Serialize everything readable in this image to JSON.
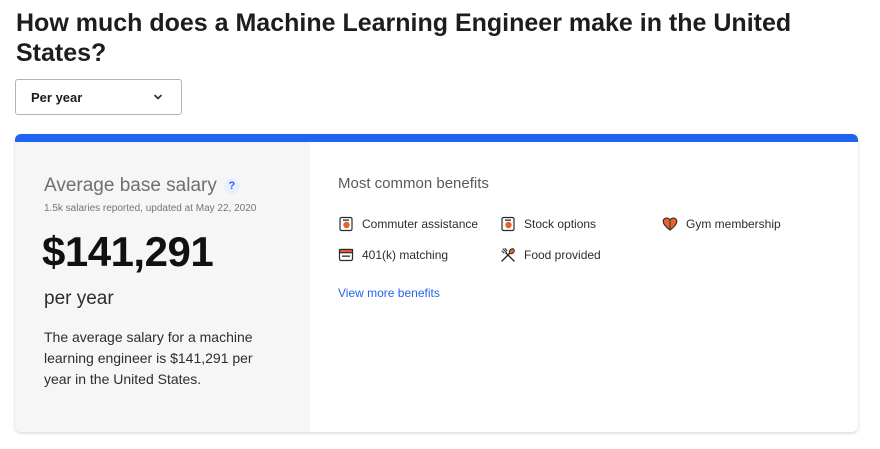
{
  "page": {
    "title": "How much does a Machine Learning Engineer make in the United States?"
  },
  "period_select": {
    "value": "Per year"
  },
  "salary_card": {
    "heading": "Average base salary",
    "help": "?",
    "meta": "1.5k salaries reported, updated at May 22, 2020",
    "amount": "$141,291",
    "period": "per year",
    "description": "The average salary for a machine learning engineer is $141,291 per year in the United States."
  },
  "benefits": {
    "heading": "Most common benefits",
    "items": [
      {
        "label": "Commuter assistance",
        "icon": "commuter-icon"
      },
      {
        "label": "Stock options",
        "icon": "stock-options-icon"
      },
      {
        "label": "Gym membership",
        "icon": "gym-heart-icon"
      },
      {
        "label": "401(k) matching",
        "icon": "401k-icon"
      },
      {
        "label": "Food provided",
        "icon": "utensils-icon"
      }
    ],
    "view_more": "View more benefits"
  },
  "colors": {
    "accent": "#2164f3",
    "icon_orange": "#e8612c",
    "left_panel_bg": "#f6f6f6"
  }
}
